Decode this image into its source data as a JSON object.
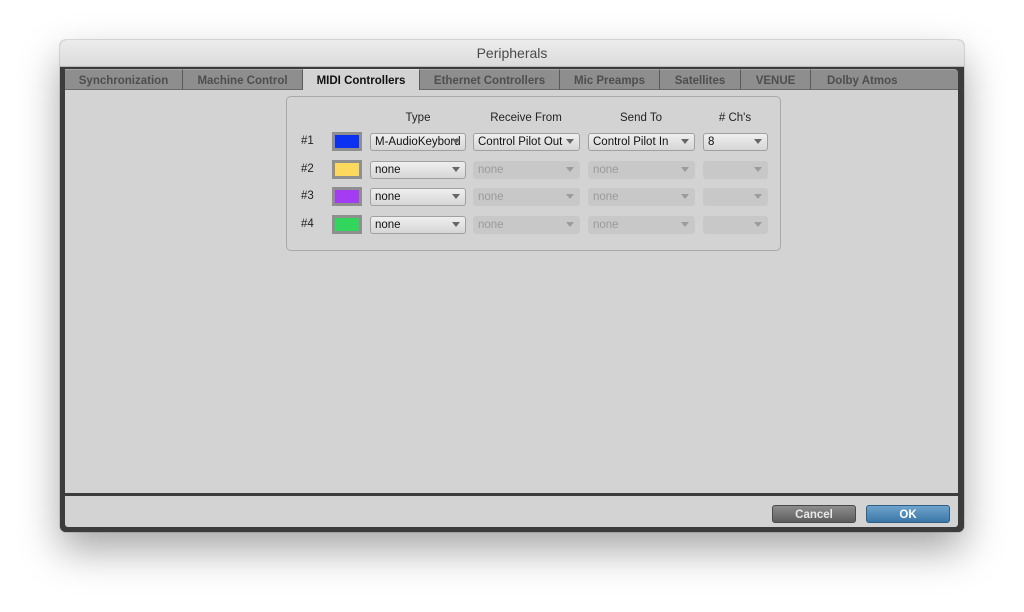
{
  "window": {
    "title": "Peripherals"
  },
  "tabs": [
    {
      "label": "Synchronization",
      "active": false
    },
    {
      "label": "Machine Control",
      "active": false
    },
    {
      "label": "MIDI Controllers",
      "active": true
    },
    {
      "label": "Ethernet Controllers",
      "active": false
    },
    {
      "label": "Mic Preamps",
      "active": false
    },
    {
      "label": "Satellites",
      "active": false
    },
    {
      "label": "VENUE",
      "active": false
    },
    {
      "label": "Dolby Atmos",
      "active": false
    }
  ],
  "midi_controllers": {
    "headers": {
      "type": "Type",
      "receive_from": "Receive From",
      "send_to": "Send To",
      "channels": "# Ch's"
    },
    "rows": [
      {
        "number": "#1",
        "color": "#0a32f0",
        "type": "M-AudioKeybord",
        "receive_from": "Control Pilot Out",
        "send_to": "Control Pilot In",
        "channels": "8",
        "enabled": true
      },
      {
        "number": "#2",
        "color": "#fcd95c",
        "type": "none",
        "receive_from": "none",
        "send_to": "none",
        "channels": "",
        "enabled": false
      },
      {
        "number": "#3",
        "color": "#a43cf4",
        "type": "none",
        "receive_from": "none",
        "send_to": "none",
        "channels": "",
        "enabled": false
      },
      {
        "number": "#4",
        "color": "#33d65c",
        "type": "none",
        "receive_from": "none",
        "send_to": "none",
        "channels": "",
        "enabled": false
      }
    ]
  },
  "footer": {
    "cancel_label": "Cancel",
    "ok_label": "OK"
  }
}
